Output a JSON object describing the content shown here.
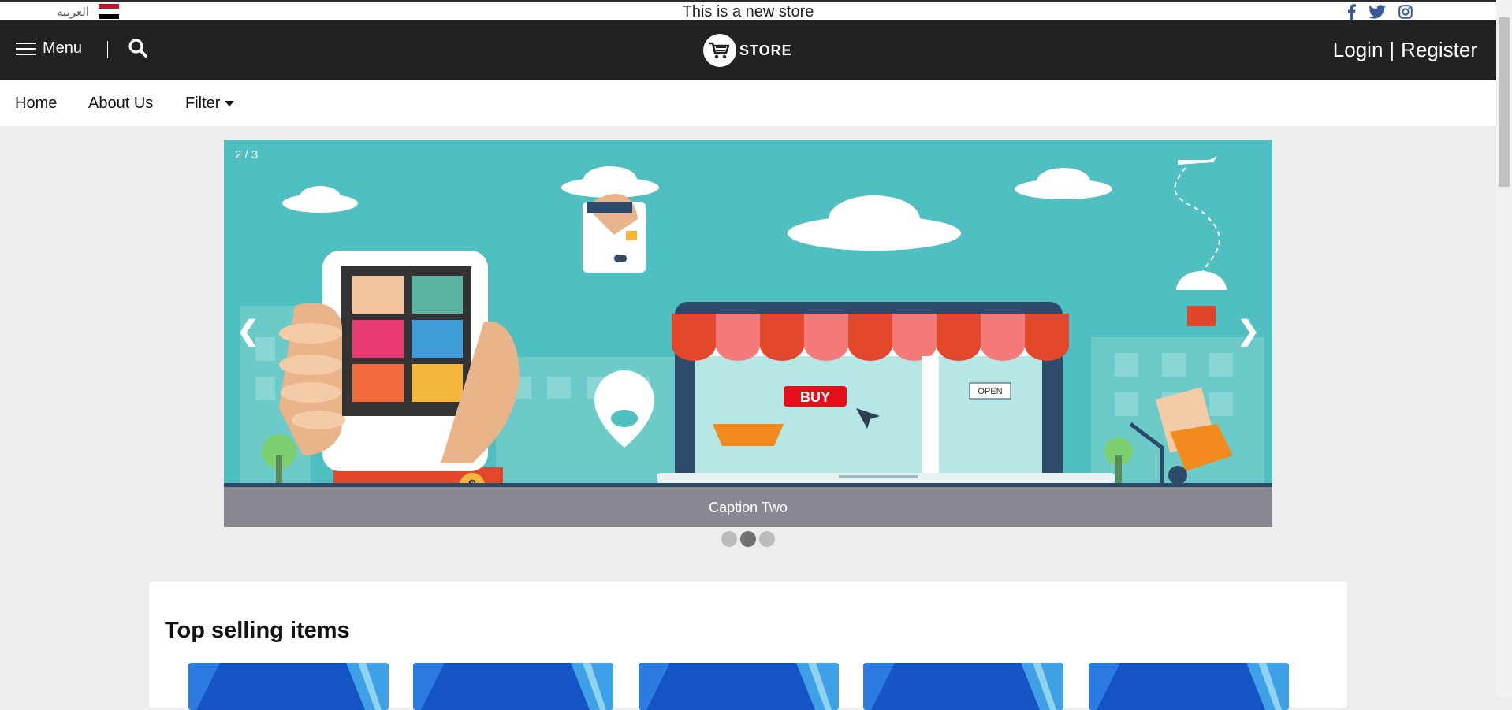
{
  "topbar": {
    "language_label": "العربيه",
    "flag_icon": "egypt-flag-icon",
    "announcement": "This is a new store",
    "social": [
      "facebook-icon",
      "twitter-icon",
      "instagram-icon"
    ],
    "social_color": "#3b5998"
  },
  "header": {
    "menu_label": "Menu",
    "search_icon": "search-icon",
    "logo_text": "STORE",
    "login_label": "Login",
    "auth_separator": "|",
    "register_label": "Register",
    "background": "#222222"
  },
  "nav": {
    "items": [
      {
        "label": "Home"
      },
      {
        "label": "About Us"
      },
      {
        "label": "Filter",
        "dropdown": true
      }
    ]
  },
  "slider": {
    "counter": "2 / 3",
    "caption": "Caption Two",
    "prev_label": "❮",
    "next_label": "❯",
    "slide_count": 3,
    "active_slide": 2,
    "scene_text": {
      "buy_sign": "BUY",
      "open_sign": "OPEN",
      "currency_symbol": "$"
    },
    "background_color": "#4fbfc1"
  },
  "products": {
    "title": "Top selling items",
    "items": [
      {
        "image": "product-image"
      },
      {
        "image": "product-image"
      },
      {
        "image": "product-image"
      },
      {
        "image": "product-image"
      },
      {
        "image": "product-image"
      }
    ]
  }
}
